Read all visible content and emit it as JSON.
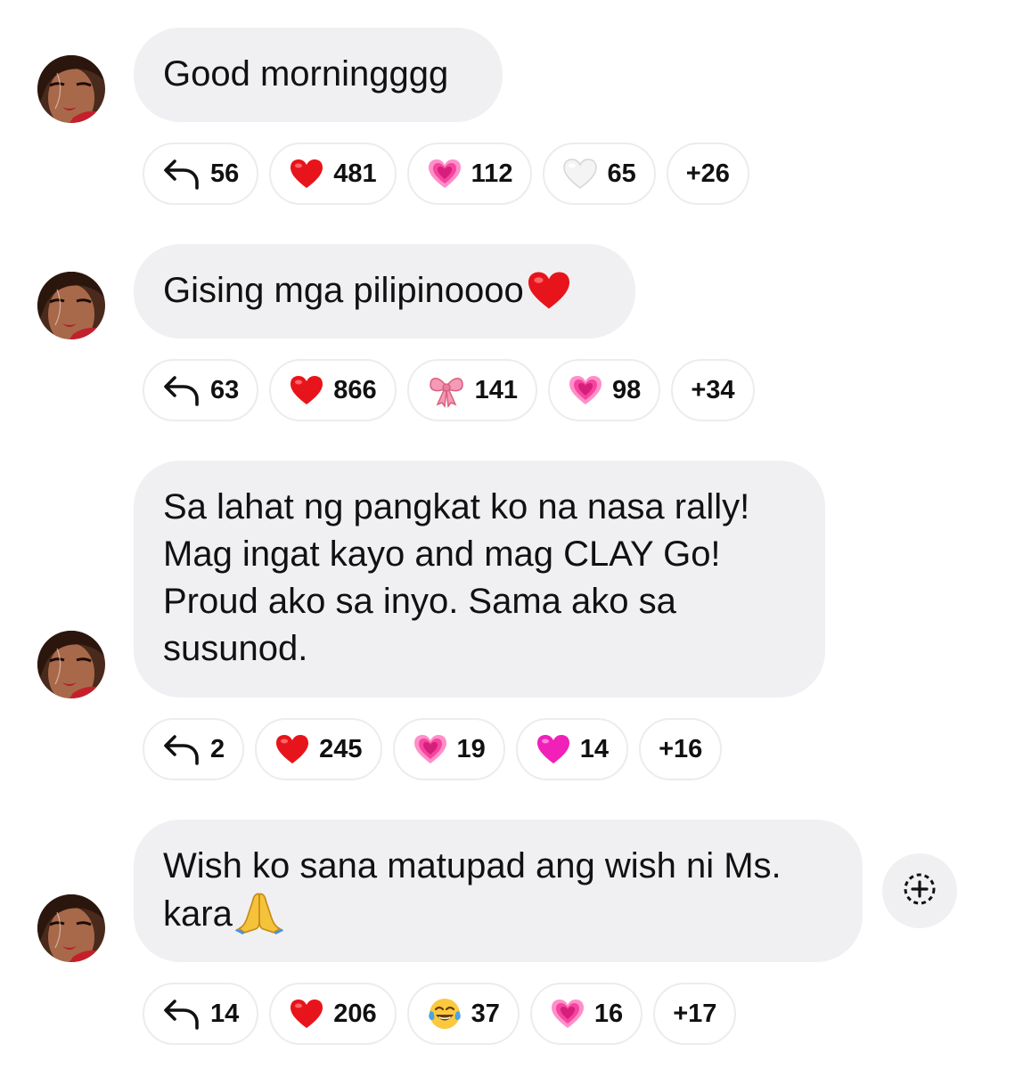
{
  "messages": [
    {
      "lines": [
        "Good morningggg"
      ],
      "reactions": [
        {
          "icon": "reply-icon",
          "count": "56"
        },
        {
          "icon": "red-heart-icon",
          "count": "481"
        },
        {
          "icon": "growing-heart-icon",
          "count": "112"
        },
        {
          "icon": "white-heart-icon",
          "count": "65"
        },
        {
          "icon": "",
          "count": "+26"
        }
      ]
    },
    {
      "lines": [
        "Gising mga pilipinoooo"
      ],
      "trailing_emoji": "red-heart-icon",
      "reactions": [
        {
          "icon": "reply-icon",
          "count": "63"
        },
        {
          "icon": "red-heart-icon",
          "count": "866"
        },
        {
          "icon": "ribbon-bow-icon",
          "count": "141"
        },
        {
          "icon": "growing-heart-icon",
          "count": "98"
        },
        {
          "icon": "",
          "count": "+34"
        }
      ]
    },
    {
      "lines": [
        "Sa lahat ng pangkat ko na nasa rally!",
        "Mag ingat kayo and mag CLAY Go!",
        "Proud ako sa inyo. Sama ako sa",
        "susunod."
      ],
      "reactions": [
        {
          "icon": "reply-icon",
          "count": "2"
        },
        {
          "icon": "red-heart-icon",
          "count": "245"
        },
        {
          "icon": "growing-heart-icon",
          "count": "19"
        },
        {
          "icon": "pink-heart-icon",
          "count": "14"
        },
        {
          "icon": "",
          "count": "+16"
        }
      ]
    },
    {
      "lines": [
        "Wish ko sana matupad ang wish ni Ms.",
        "kara"
      ],
      "trailing_emoji": "folded-hands-icon",
      "reactions": [
        {
          "icon": "reply-icon",
          "count": "14"
        },
        {
          "icon": "red-heart-icon",
          "count": "206"
        },
        {
          "icon": "tears-of-joy-icon",
          "count": "37"
        },
        {
          "icon": "growing-heart-icon",
          "count": "16"
        },
        {
          "icon": "",
          "count": "+17"
        }
      ]
    }
  ],
  "colors": {
    "bubble_bg": "#f0f0f2",
    "pill_border": "#ececee",
    "text": "#111111"
  }
}
